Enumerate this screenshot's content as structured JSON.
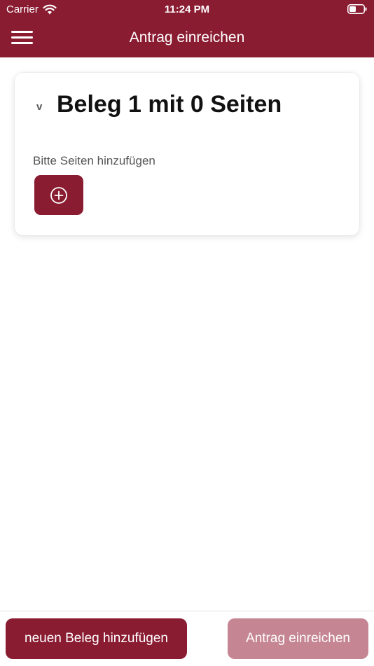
{
  "status_bar": {
    "carrier": "Carrier",
    "time": "11:24 PM"
  },
  "nav": {
    "title": "Antrag einreichen"
  },
  "receipt": {
    "toggle_glyph": "v",
    "title": "Beleg 1 mit 0 Seiten",
    "hint": "Bitte Seiten hinzufügen"
  },
  "footer": {
    "new_receipt_label": "neuen Beleg hinzufügen",
    "submit_label": "Antrag einreichen"
  },
  "colors": {
    "brand": "#8a1c32",
    "brand_disabled": "#c58592"
  }
}
